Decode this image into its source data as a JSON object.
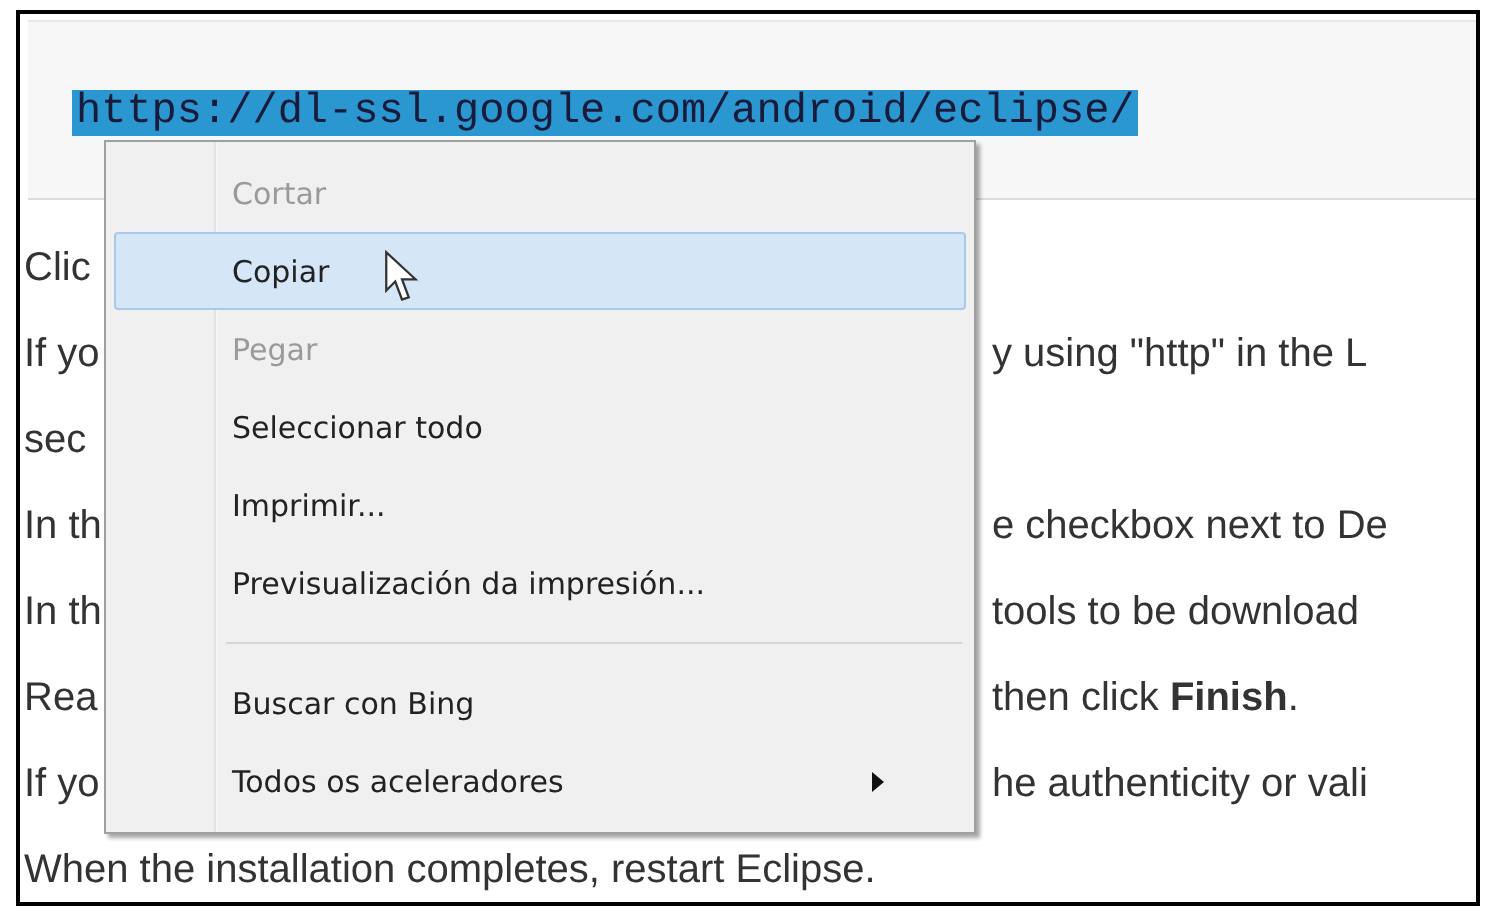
{
  "code_box": {
    "url": "https://dl-ssl.google.com/android/eclipse/",
    "selected": true
  },
  "lines": [
    {
      "left": "Clic"
    },
    {
      "left": "If yo",
      "right": "y using \"http\" in the L"
    },
    {
      "left": "sec"
    },
    {
      "left": "In th",
      "right": "e checkbox next to De"
    },
    {
      "left": "In th",
      "right": "tools to be download"
    },
    {
      "left": "Rea",
      "right": "then click **Finish**."
    },
    {
      "left": "If yo",
      "right": "he authenticity or vali"
    },
    {
      "left": "When the installation completes, restart Eclipse."
    }
  ],
  "context_menu": {
    "items": [
      {
        "kind": "item",
        "label": "Cortar",
        "disabled": true,
        "selected": false,
        "submenu": false
      },
      {
        "kind": "item",
        "label": "Copiar",
        "disabled": false,
        "selected": true,
        "submenu": false
      },
      {
        "kind": "item",
        "label": "Pegar",
        "disabled": true,
        "selected": false,
        "submenu": false
      },
      {
        "kind": "item",
        "label": "Seleccionar todo",
        "disabled": false,
        "selected": false,
        "submenu": false
      },
      {
        "kind": "item",
        "label": "Imprimir...",
        "disabled": false,
        "selected": false,
        "submenu": false
      },
      {
        "kind": "item",
        "label": "Previsualización da impresión...",
        "disabled": false,
        "selected": false,
        "submenu": false
      },
      {
        "kind": "separator"
      },
      {
        "kind": "item",
        "label": "Buscar con Bing",
        "disabled": false,
        "selected": false,
        "submenu": false
      },
      {
        "kind": "item",
        "label": "Todos os aceleradores",
        "disabled": false,
        "selected": false,
        "submenu": true
      }
    ]
  }
}
